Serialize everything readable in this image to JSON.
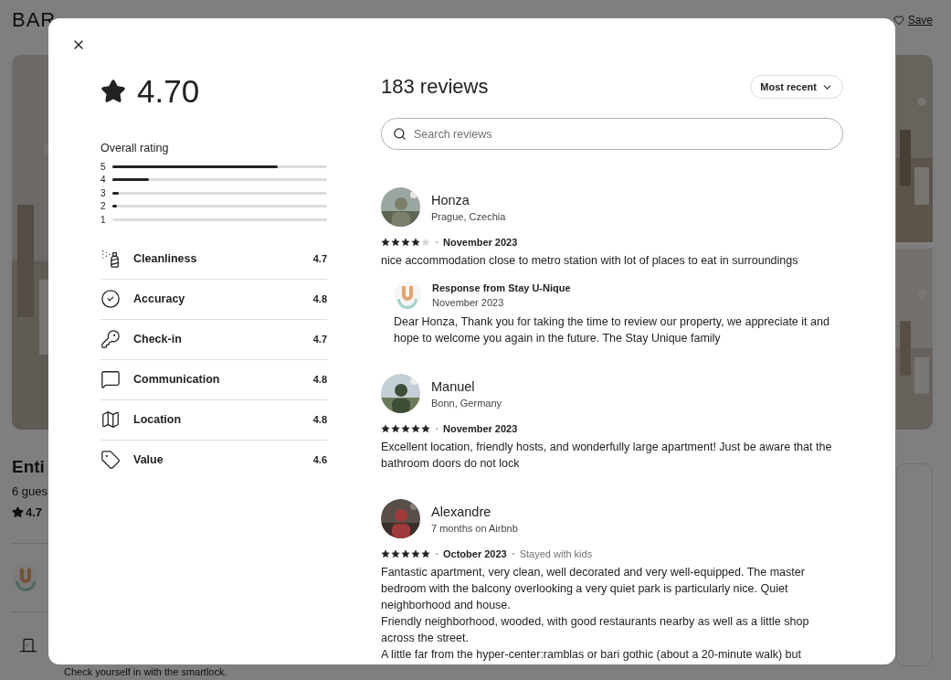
{
  "background_page": {
    "title": "BAR",
    "save": "Save",
    "listing_title": "Enti",
    "guests": "6 gues",
    "rating": "4.7",
    "checkin_note": "Check yourself in with the smartlock."
  },
  "reviews_dialog": {
    "rating": "4.70",
    "overall": {
      "label": "Overall rating",
      "bars": [
        {
          "label": "5",
          "level": 0.77
        },
        {
          "label": "4",
          "level": 0.17
        },
        {
          "label": "3",
          "level": 0.03
        },
        {
          "label": "2",
          "level": 0.02
        },
        {
          "label": "1",
          "level": 0
        }
      ]
    },
    "categories": [
      {
        "kind": "cleanliness",
        "label": "Cleanliness",
        "score": "4.7"
      },
      {
        "kind": "accuracy",
        "label": "Accuracy",
        "score": "4.8"
      },
      {
        "kind": "checkin",
        "label": "Check-in",
        "score": "4.7"
      },
      {
        "kind": "communication",
        "label": "Communication",
        "score": "4.8"
      },
      {
        "kind": "location",
        "label": "Location",
        "score": "4.8"
      },
      {
        "kind": "value",
        "label": "Value",
        "score": "4.6"
      }
    ],
    "heading": "183 reviews",
    "sort": "Most recent",
    "search": {
      "placeholder": "Search reviews"
    },
    "reviews": [
      {
        "name": "Honza",
        "subtitle": "Prague, Czechia",
        "stars": 4,
        "date": "November 2023",
        "text": "nice accommodation close to metro station with lot of places to eat in surroundings",
        "response": {
          "title": "Response from Stay U-Nique",
          "date": "November 2023",
          "text": "Dear Honza, Thank you for taking the time to review our property, we appreciate it and hope to welcome you again in the future. The Stay Unique family"
        }
      },
      {
        "name": "Manuel",
        "subtitle": "Bonn, Germany",
        "stars": 5,
        "date": "November 2023",
        "text": "Excellent location, friendly hosts, and wonderfully large apartment! Just be aware that the bathroom doors do not lock"
      },
      {
        "name": "Alexandre",
        "subtitle": "7 months on Airbnb",
        "stars": 5,
        "date": "October 2023",
        "trip": "Stayed with kids",
        "text": "Fantastic apartment, very clean, well decorated and very well-equipped. The master bedroom with the balcony overlooking a very quiet park is particularly nice. Quiet neighborhood and house.\nFriendly neighborhood, wooded, with good restaurants nearby as well as a little shop across the street.\nA little far from the hyper-center:ramblas or bari gothic (about a 20-minute walk) but"
      }
    ]
  }
}
